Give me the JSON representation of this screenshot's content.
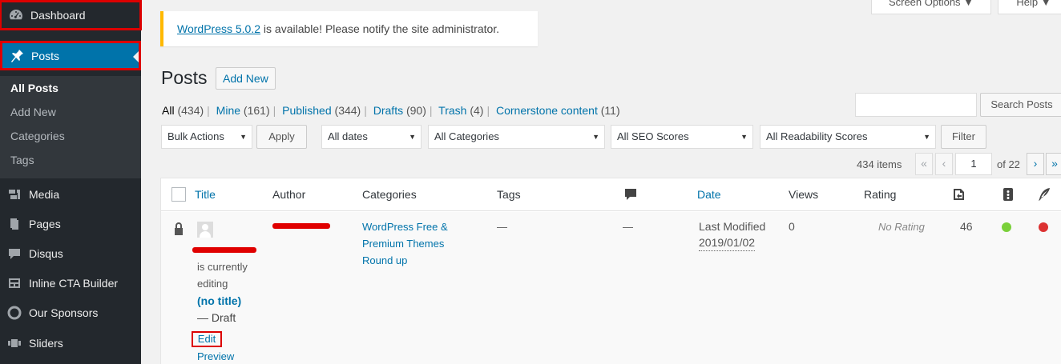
{
  "sidebar": {
    "dashboard": "Dashboard",
    "posts": "Posts",
    "submenu": [
      "All Posts",
      "Add New",
      "Categories",
      "Tags"
    ],
    "items": [
      {
        "label": "Media",
        "icon": "media-icon"
      },
      {
        "label": "Pages",
        "icon": "pages-icon"
      },
      {
        "label": "Disqus",
        "icon": "comment-icon"
      },
      {
        "label": "Inline CTA Builder",
        "icon": "cta-icon"
      },
      {
        "label": "Our Sponsors",
        "icon": "circle-icon"
      },
      {
        "label": "Sliders",
        "icon": "slider-icon"
      }
    ]
  },
  "notice": {
    "link": "WordPress 5.0.2",
    "text": " is available! Please notify the site administrator."
  },
  "header": {
    "screen_options": "Screen Options",
    "help": "Help",
    "title": "Posts",
    "add_new": "Add New"
  },
  "filters": {
    "all": "All",
    "all_count": "(434)",
    "mine": "Mine",
    "mine_count": "(161)",
    "published": "Published",
    "published_count": "(344)",
    "drafts": "Drafts",
    "drafts_count": "(90)",
    "trash": "Trash",
    "trash_count": "(4)",
    "cornerstone": "Cornerstone content",
    "cornerstone_count": "(11)"
  },
  "search": {
    "button": "Search Posts",
    "value": ""
  },
  "toolbar": {
    "bulk_actions": "Bulk Actions",
    "apply": "Apply",
    "dates": "All dates",
    "categories": "All Categories",
    "seo": "All SEO Scores",
    "readability": "All Readability Scores",
    "filter": "Filter"
  },
  "pagination": {
    "items": "434 items",
    "first": "«",
    "prev": "‹",
    "current": "1",
    "of": "of 22",
    "next": "›",
    "last": "»"
  },
  "table": {
    "headers": {
      "title": "Title",
      "author": "Author",
      "categories": "Categories",
      "tags": "Tags",
      "date": "Date",
      "views": "Views",
      "rating": "Rating"
    },
    "row": {
      "editing_1": "is currently",
      "editing_2": "editing",
      "title": "(no title)",
      "status": "— Draft",
      "edit": "Edit",
      "preview": "Preview",
      "category_1": "WordPress Free &",
      "category_2": "Premium Themes",
      "category_3": "Round up",
      "tags": "—",
      "comments": "—",
      "date_label": "Last Modified",
      "date": "2019/01/02",
      "views": "0",
      "rating": "No Rating",
      "links": "46",
      "seo_color": "#7ad03a",
      "readability_color": "#dc3232"
    }
  }
}
